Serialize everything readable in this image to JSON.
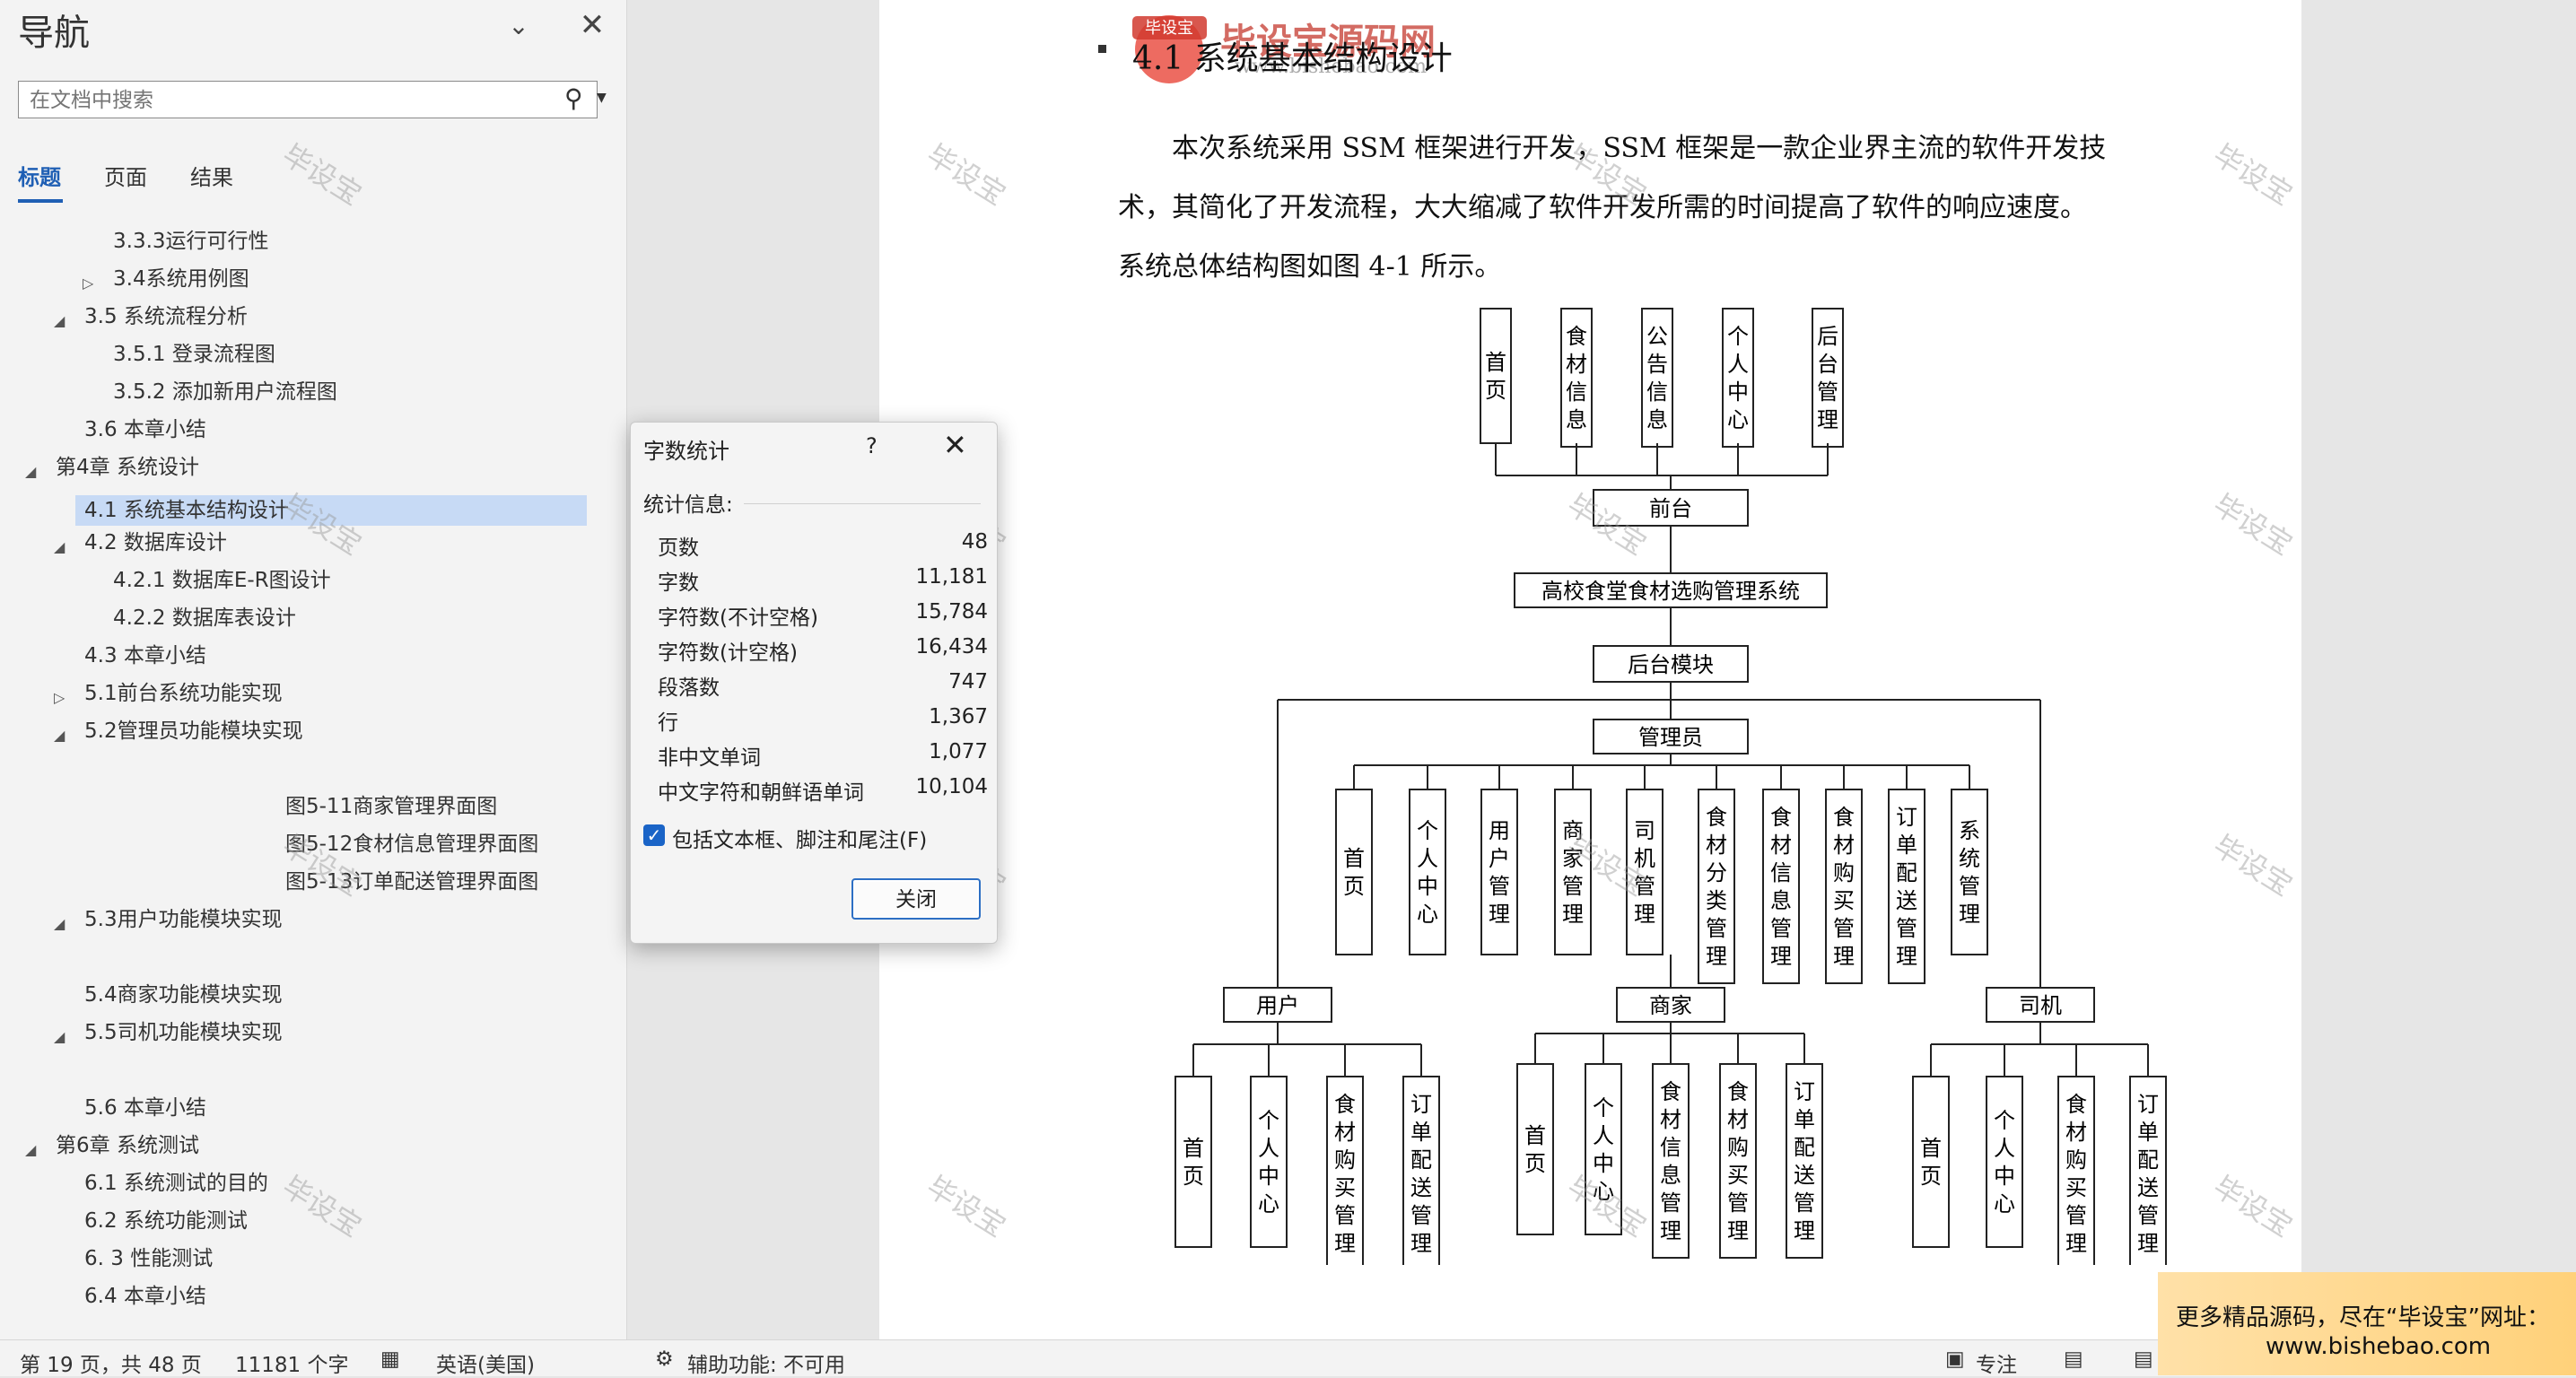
{
  "nav": {
    "title": "导航",
    "search_placeholder": "在文档中搜索",
    "tabs": [
      "标题",
      "页面",
      "结果"
    ],
    "tree": [
      {
        "label": "3.3.3运行可行性"
      },
      {
        "label": "3.4系统用例图"
      },
      {
        "label": "3.5 系统流程分析"
      },
      {
        "label": "3.5.1 登录流程图"
      },
      {
        "label": "3.5.2 添加新用户流程图"
      },
      {
        "label": "3.6 本章小结"
      },
      {
        "label": "第4章 系统设计"
      },
      {
        "label": "4.1 系统基本结构设计"
      },
      {
        "label": "4.2 数据库设计"
      },
      {
        "label": "4.2.1 数据库E-R图设计"
      },
      {
        "label": "4.2.2 数据库表设计"
      },
      {
        "label": "4.3 本章小结"
      },
      {
        "label": "5.1前台系统功能实现"
      },
      {
        "label": "5.2管理员功能模块实现"
      },
      {
        "label": "图5-11商家管理界面图"
      },
      {
        "label": "图5-12食材信息管理界面图"
      },
      {
        "label": "图5-13订单配送管理界面图"
      },
      {
        "label": "5.3用户功能模块实现"
      },
      {
        "label": "5.4商家功能模块实现"
      },
      {
        "label": "5.5司机功能模块实现"
      },
      {
        "label": "5.6 本章小结"
      },
      {
        "label": "第6章 系统测试"
      },
      {
        "label": "6.1 系统测试的目的"
      },
      {
        "label": "6.2 系统功能测试"
      },
      {
        "label": "6. 3 性能测试"
      },
      {
        "label": "6.4 本章小结"
      }
    ]
  },
  "document": {
    "heading": "4.1  系统基本结构设计",
    "paragraph_lines": [
      "本次系统采用 SSM 框架进行开发，SSM 框架是一款企业界主流的软件开发技",
      "术，其简化了开发流程，大大缩减了软件开发所需的时间提高了软件的响应速度。",
      "系统总体结构图如图 4-1 所示。"
    ],
    "logo_text": "毕设宝源码网",
    "logo_badge": "毕设宝",
    "logo_url": "www.bishebao.com",
    "watermark": "毕设宝",
    "diagram": {
      "front_items": [
        "首页",
        "食材信息",
        "公告信息",
        "个人中心",
        "后台管理"
      ],
      "front_node": "前台",
      "system_node": "高校食堂食材选购管理系统",
      "backend_node": "后台模块",
      "admin_node": "管理员",
      "admin_items": [
        "首页",
        "个人中心",
        "用户管理",
        "商家管理",
        "司机管理",
        "食材分类管理",
        "食材信息管理",
        "食材购买管理",
        "订单配送管理",
        "系统管理"
      ],
      "user_node": "用户",
      "merchant_node": "商家",
      "driver_node": "司机",
      "user_items": [
        "首页",
        "个人中心",
        "食材购买管理",
        "订单配送管理"
      ],
      "merchant_items": [
        "首页",
        "个人中心",
        "食材信息管理",
        "食材购买管理",
        "订单配送管理"
      ],
      "driver_items": [
        "首页",
        "个人中心",
        "食材购买管理",
        "订单配送管理"
      ]
    }
  },
  "dialog": {
    "title": "字数统计",
    "help": "?",
    "subtitle": "统计信息:",
    "stats": [
      {
        "label": "页数",
        "value": "48"
      },
      {
        "label": "字数",
        "value": "11,181"
      },
      {
        "label": "字符数(不计空格)",
        "value": "15,784"
      },
      {
        "label": "字符数(计空格)",
        "value": "16,434"
      },
      {
        "label": "段落数",
        "value": "747"
      },
      {
        "label": "行",
        "value": "1,367"
      },
      {
        "label": "非中文单词",
        "value": "1,077"
      },
      {
        "label": "中文字符和朝鲜语单词",
        "value": "10,104"
      }
    ],
    "checkbox_label": "包括文本框、脚注和尾注(F)",
    "checkbox_checked": true,
    "close_label": "关闭"
  },
  "statusbar": {
    "page": "第 19 页，共 48 页",
    "words": "11181 个字",
    "language": "英语(美国)",
    "accessibility": "辅助功能: 不可用",
    "focus": "专注"
  },
  "ad": {
    "line1": "更多精品源码，尽在“毕设宝”网址：",
    "line2": "www.bishebao.com"
  }
}
